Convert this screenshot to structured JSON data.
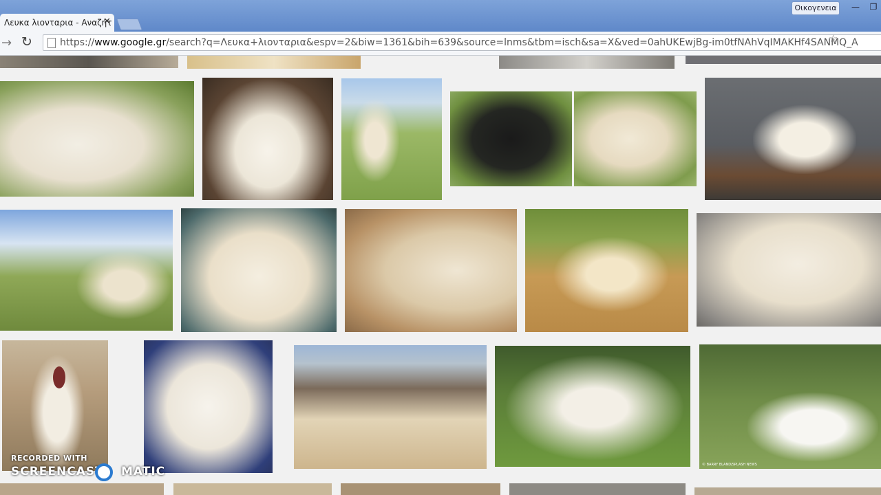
{
  "window": {
    "tab_title": "Λευκα λιονταρια - Αναζήτ",
    "tab_close": "✕",
    "profile_label": "Οικογενεια",
    "minimize": "—",
    "restore": "❐"
  },
  "toolbar": {
    "forward_icon": "→",
    "reload_icon": "↻",
    "url_scheme": "https://",
    "url_host": "www.google.gr",
    "url_rest": "/search?q=Λευκα+λιονταρια&espv=2&biw=1361&bih=639&source=lnms&tbm=isch&sa=X&ved=0ahUKEwjBg-im0tfNAhVqIMAKHf4SANMQ_A",
    "star_icon": "☆"
  },
  "results": {
    "thumb_credit": "© BARRY BLAND/SPLASH NEWS"
  },
  "watermark": {
    "line1": "RECORDED WITH",
    "line2a": "SCREENCAST",
    "line2b": "MATIC"
  }
}
